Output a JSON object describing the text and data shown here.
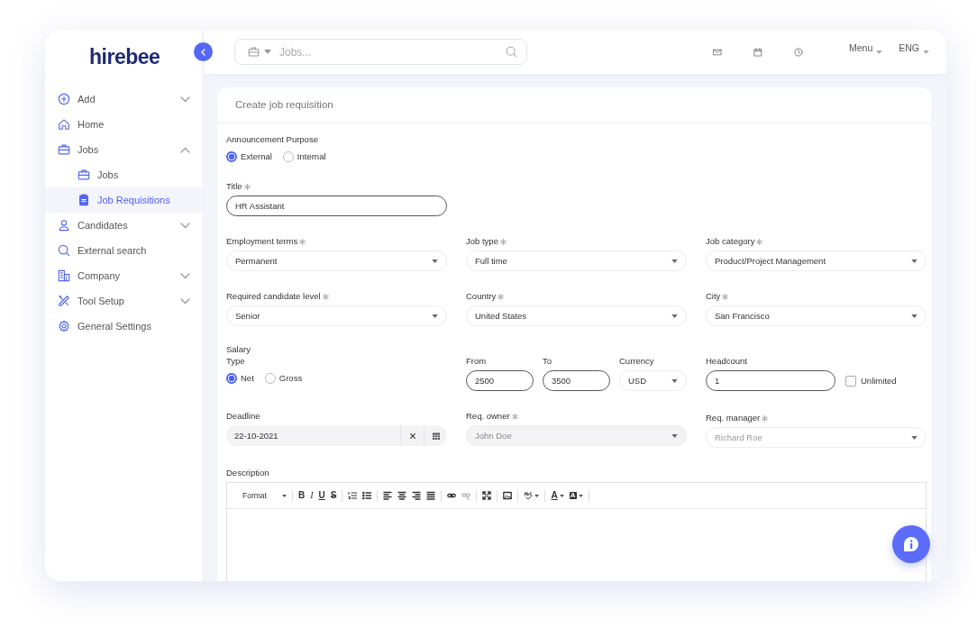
{
  "logo": {
    "text": "hirebee"
  },
  "sidebar": {
    "items": [
      {
        "label": "Add",
        "expanded": false,
        "selected": false
      },
      {
        "label": "Home",
        "selected": false
      },
      {
        "label": "Jobs",
        "expanded": true,
        "selected": false,
        "children": [
          {
            "label": "Jobs",
            "selected": false
          },
          {
            "label": "Job Requisitions",
            "selected": true
          }
        ]
      },
      {
        "label": "Candidates",
        "expanded": false,
        "selected": false
      },
      {
        "label": "External search",
        "selected": false
      },
      {
        "label": "Company",
        "expanded": false,
        "selected": false
      },
      {
        "label": "Tool Setup",
        "expanded": false,
        "selected": false
      },
      {
        "label": "General Settings",
        "selected": false
      }
    ]
  },
  "topbar": {
    "search": {
      "placeholder": "Jobs..."
    },
    "menus": [
      "Menu",
      "ENG"
    ]
  },
  "card": {
    "title": "Create job requisition"
  },
  "form": {
    "purpose": {
      "label": "Announcement Purpose",
      "options": [
        {
          "label": "External",
          "selected": true
        },
        {
          "label": "Internal",
          "selected": false
        }
      ]
    },
    "title": {
      "label": "Title",
      "required": true,
      "value": "HR Assistant"
    },
    "select_rows": [
      [
        {
          "label": "Employment terms",
          "required": true,
          "value": "Permanent"
        },
        {
          "label": "Job type",
          "required": true,
          "value": "Full time"
        },
        {
          "label": "Job category",
          "required": true,
          "value": "Product/Project Management"
        }
      ],
      [
        {
          "label": "Required candidate level",
          "required": true,
          "value": "Senior"
        },
        {
          "label": "Country",
          "required": true,
          "value": "United States"
        },
        {
          "label": "City",
          "required": true,
          "value": "San Francisco"
        }
      ]
    ],
    "salary": {
      "label": "Salary",
      "type_label": "Type",
      "types": [
        {
          "label": "Net",
          "selected": true
        },
        {
          "label": "Gross",
          "selected": false
        }
      ],
      "from": {
        "label": "From",
        "value": "2500"
      },
      "to": {
        "label": "To",
        "value": "3500"
      },
      "currency": {
        "label": "Currency",
        "value": "USD"
      }
    },
    "headcount": {
      "label": "Headcount",
      "value": "1"
    },
    "unlimited": {
      "label": "Unlimited",
      "checked": false
    },
    "deadline": {
      "label": "Deadline",
      "value": "22-10-2021"
    },
    "req_owner": {
      "label": "Req. owner",
      "required": true,
      "value": "John Doe",
      "disabled": true
    },
    "req_manager": {
      "label": "Req. manager",
      "required": true,
      "placeholder": "Richard Roe",
      "disabled": false
    },
    "description": {
      "label": "Description",
      "toolbar": [
        [
          {
            "kind": "format",
            "label": "Format",
            "disabled": false
          }
        ],
        [
          {
            "kind": "bold",
            "label": "B",
            "disabled": false
          },
          {
            "kind": "italic",
            "label": "I",
            "disabled": false
          },
          {
            "kind": "underline",
            "label": "U",
            "disabled": false
          },
          {
            "kind": "strike",
            "label": "S",
            "disabled": false
          }
        ],
        [
          {
            "kind": "ordered-list",
            "disabled": false
          },
          {
            "kind": "bullet-list",
            "disabled": false
          }
        ],
        [
          {
            "kind": "align-left",
            "disabled": false
          },
          {
            "kind": "align-center",
            "disabled": false
          },
          {
            "kind": "align-right",
            "disabled": false
          },
          {
            "kind": "justify",
            "disabled": false
          }
        ],
        [
          {
            "kind": "link",
            "disabled": false
          },
          {
            "kind": "unlink",
            "disabled": true
          }
        ],
        [
          {
            "kind": "maximize",
            "disabled": false
          }
        ],
        [
          {
            "kind": "image",
            "disabled": false
          }
        ],
        [
          {
            "kind": "spellcheck",
            "disabled": false
          }
        ],
        [
          {
            "kind": "text-color",
            "label": "A",
            "disabled": false
          },
          {
            "kind": "background-color",
            "label": "A",
            "disabled": false
          }
        ]
      ]
    }
  }
}
